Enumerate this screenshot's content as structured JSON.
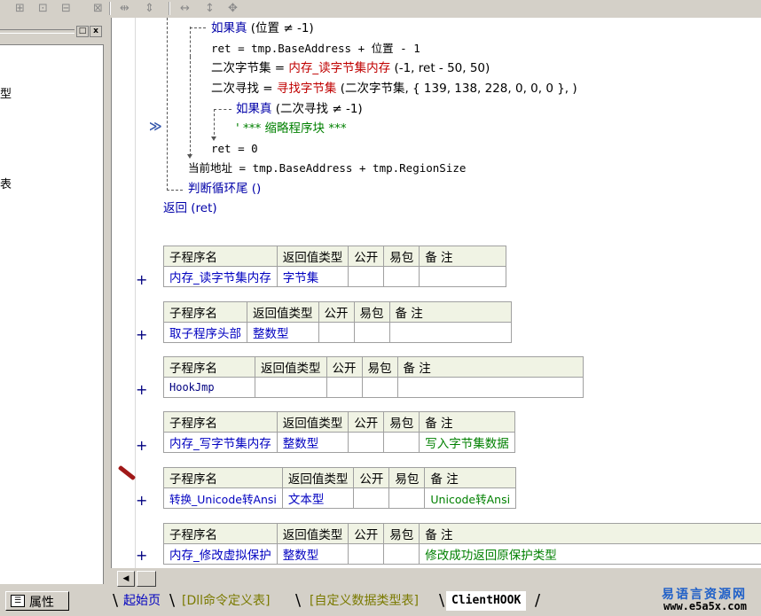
{
  "toolbar": {
    "buttons": [
      "align-left-icon",
      "align-center-icon",
      "align-top-icon",
      "align-middle-icon",
      "same-width-icon",
      "same-height-icon",
      "h-space-icon",
      "v-space-icon",
      "center-icon"
    ]
  },
  "left_panel": {
    "close_glyph": "x",
    "restore_glyph": "□",
    "fragments": [
      "型",
      "表"
    ],
    "prop_tab": "属性"
  },
  "code": {
    "line1_kw": "如果真",
    "line1_rest": " (位置 ≠ -1)",
    "line2": "ret = tmp.BaseAddress + 位置 - 1",
    "line3_a": "二次字节集 = ",
    "line3_fn": "内存_读字节集内存",
    "line3_args": " (-1, ret - 50, 50)",
    "line4_a": "二次寻找 = ",
    "line4_fn": "寻找字节集",
    "line4_args": " (二次字节集, { 139, 138, 228, 0, 0, 0 }, )",
    "line5_kw": "如果真",
    "line5_rest": " (二次寻找 ≠ -1)",
    "line6": "' *** 缩略程序块 ***",
    "line7": "ret = 0",
    "line8": "当前地址 = tmp.BaseAddress + tmp.RegionSize",
    "line9": "判断循环尾 ()",
    "line10": "返回 (ret)",
    "marker": "≫"
  },
  "headers": {
    "name": "子程序名",
    "rettype": "返回值类型",
    "public": "公开",
    "easy": "易包",
    "note": "备 注"
  },
  "subs": [
    {
      "name": "内存_读字节集内存",
      "type": "字节集",
      "note": ""
    },
    {
      "name": "取子程序头部",
      "type": "整数型",
      "note": ""
    },
    {
      "name": "HookJmp",
      "type": "",
      "note": ""
    },
    {
      "name": "内存_写字节集内存",
      "type": "整数型",
      "note": "写入字节集数据"
    },
    {
      "name": "转换_Unicode转Ansi",
      "type": "文本型",
      "note": "Unicode转Ansi"
    },
    {
      "name": "内存_修改虚拟保护",
      "type": "整数型",
      "note": "修改成功返回原保护类型"
    }
  ],
  "plus": "+",
  "tabs": {
    "t1": "起始页",
    "t2": "[Dll命令定义表]",
    "t3": "[自定义数据类型表]",
    "t4": "ClientHOOK"
  },
  "logo": {
    "line1": "易语言资源网",
    "line2": "www.e5a5x.com"
  }
}
